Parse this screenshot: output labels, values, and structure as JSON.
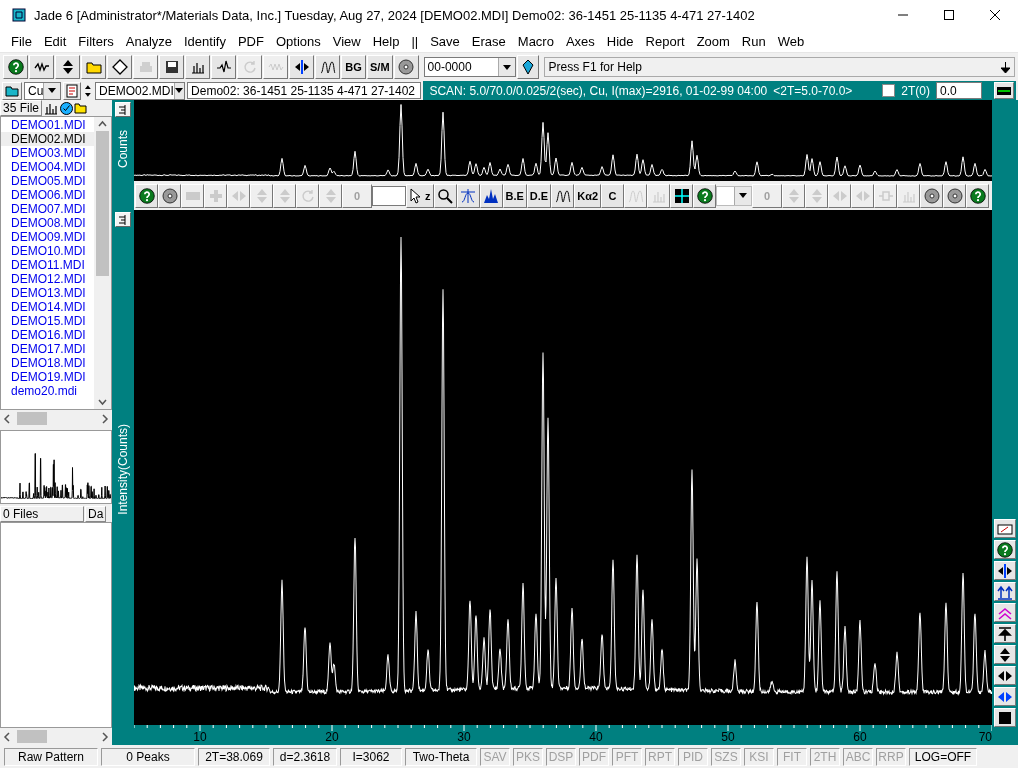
{
  "window": {
    "title": "Jade 6 [Administrator*/Materials Data, Inc.] Tuesday, Aug 27, 2024 [DEMO02.MDI] Demo02: 36-1451 25-1135 4-471 27-1402"
  },
  "menu": [
    "File",
    "Edit",
    "Filters",
    "Analyze",
    "Identify",
    "PDF",
    "Options",
    "View",
    "Help",
    "||",
    "Save",
    "Erase",
    "Macro",
    "Axes",
    "Hide",
    "Report",
    "Zoom",
    "Run",
    "Web"
  ],
  "main_toolbar": {
    "buttons": [
      {
        "kind": "help",
        "disabled": false
      },
      {
        "kind": "scribble",
        "disabled": false
      },
      {
        "kind": "updown",
        "disabled": false
      },
      {
        "kind": "folder",
        "disabled": false
      },
      {
        "kind": "diamond",
        "disabled": false
      },
      {
        "kind": "printer",
        "disabled": true
      },
      {
        "kind": "save",
        "disabled": false
      },
      {
        "kind": "bars",
        "disabled": false
      },
      {
        "kind": "peak",
        "disabled": false
      },
      {
        "kind": "rotate",
        "disabled": true
      },
      {
        "kind": "wave",
        "disabled": true
      },
      {
        "kind": "squeeze",
        "disabled": false
      },
      {
        "kind": "peaks",
        "disabled": false
      },
      {
        "kind": "text",
        "label": "BG",
        "disabled": false
      },
      {
        "kind": "text",
        "label": "S/M",
        "disabled": false
      },
      {
        "kind": "disc",
        "disabled": false
      }
    ],
    "pdf_field": "00-0000",
    "hint": "Press F1 for Help"
  },
  "info_bar": {
    "radiation": "Cu",
    "file_combo": "DEMO02.MDI",
    "pattern_field": "Demo02: 36-1451 25-1135 4-471 27-1402",
    "scan_info": "SCAN: 5.0/70.0/0.025/2(sec), Cu, I(max)=2916, 01-02-99 04:00",
    "range": "<2T=5.0-70.0>",
    "offset_checked": false,
    "offset_label": "2T(0)",
    "offset_value": "0.0"
  },
  "file_panel": {
    "header": "35 File",
    "files": [
      {
        "name": "DEMO01.MDI",
        "selected": false
      },
      {
        "name": "DEMO02.MDI",
        "selected": true
      },
      {
        "name": "DEMO03.MDI",
        "selected": false
      },
      {
        "name": "DEMO04.MDI",
        "selected": false
      },
      {
        "name": "DEMO05.MDI",
        "selected": false
      },
      {
        "name": "DEMO06.MDI",
        "selected": false
      },
      {
        "name": "DEMO07.MDI",
        "selected": false
      },
      {
        "name": "DEMO08.MDI",
        "selected": false
      },
      {
        "name": "DEMO09.MDI",
        "selected": false
      },
      {
        "name": "DEMO10.MDI",
        "selected": false
      },
      {
        "name": "DEMO11.MDI",
        "selected": false
      },
      {
        "name": "DEMO12.MDI",
        "selected": false
      },
      {
        "name": "DEMO13.MDI",
        "selected": false
      },
      {
        "name": "DEMO14.MDI",
        "selected": false
      },
      {
        "name": "DEMO15.MDI",
        "selected": false
      },
      {
        "name": "DEMO16.MDI",
        "selected": false
      },
      {
        "name": "DEMO17.MDI",
        "selected": false
      },
      {
        "name": "DEMO18.MDI",
        "selected": false
      },
      {
        "name": "DEMO19.MDI",
        "selected": false
      },
      {
        "name": "demo20.mdi",
        "selected": false
      }
    ]
  },
  "second_panel": {
    "header": "0 Files",
    "column": "Da"
  },
  "plot": {
    "top_axis_label": "Counts",
    "axis_label": "Intensity(Counts)",
    "toolbar": [
      {
        "kind": "help",
        "disabled": false
      },
      {
        "kind": "disc",
        "disabled": false
      },
      {
        "kind": "minus",
        "disabled": true
      },
      {
        "kind": "plus",
        "disabled": true
      },
      {
        "kind": "leftright",
        "disabled": true
      },
      {
        "kind": "updown",
        "disabled": true
      },
      {
        "kind": "updown",
        "disabled": true
      },
      {
        "kind": "rotate",
        "disabled": true
      },
      {
        "kind": "updown",
        "disabled": true
      },
      {
        "kind": "field",
        "label": "0",
        "disabled": true
      },
      {
        "kind": "blank",
        "disabled": false
      },
      {
        "kind": "cursor",
        "label": "z",
        "disabled": false
      },
      {
        "kind": "magnify",
        "disabled": false
      },
      {
        "kind": "peakline",
        "disabled": false
      },
      {
        "kind": "bluepeaks",
        "disabled": false
      },
      {
        "kind": "text",
        "label": "B.E",
        "disabled": false
      },
      {
        "kind": "text",
        "label": "D.E",
        "disabled": false
      },
      {
        "kind": "peaks",
        "disabled": false
      },
      {
        "kind": "text",
        "label": "Kα2",
        "disabled": false
      },
      {
        "kind": "text",
        "label": "C",
        "disabled": false
      },
      {
        "kind": "peaks",
        "disabled": true
      },
      {
        "kind": "bars",
        "disabled": true
      },
      {
        "kind": "grid",
        "disabled": false
      },
      {
        "kind": "help",
        "disabled": false
      },
      {
        "kind": "combo",
        "disabled": true
      },
      {
        "kind": "field",
        "label": "0",
        "disabled": true
      },
      {
        "kind": "updown",
        "disabled": true
      },
      {
        "kind": "updown",
        "disabled": true
      },
      {
        "kind": "leftright",
        "disabled": true
      },
      {
        "kind": "leftright",
        "disabled": true
      },
      {
        "kind": "plug",
        "disabled": true
      },
      {
        "kind": "bars",
        "disabled": true
      },
      {
        "kind": "disc",
        "disabled": false
      },
      {
        "kind": "disc",
        "disabled": false
      },
      {
        "kind": "help",
        "disabled": false
      }
    ],
    "x_labels": [
      "10",
      "20",
      "30",
      "40",
      "50",
      "60",
      "70"
    ]
  },
  "right_tools": [
    {
      "kind": "gauge",
      "disabled": false
    },
    {
      "kind": "help",
      "disabled": false
    },
    {
      "kind": "squeeze",
      "disabled": false
    },
    {
      "kind": "ups",
      "disabled": false
    },
    {
      "kind": "chevrons",
      "disabled": false
    },
    {
      "kind": "arrowtop",
      "disabled": false
    },
    {
      "kind": "updown",
      "disabled": false
    },
    {
      "kind": "leftright",
      "disabled": false
    },
    {
      "kind": "blueleftright",
      "disabled": false
    },
    {
      "kind": "square",
      "disabled": false
    }
  ],
  "status": [
    {
      "text": "Raw Pattern",
      "disabled": false
    },
    {
      "text": "0 Peaks",
      "disabled": false
    },
    {
      "text": "2T=38.069",
      "disabled": false
    },
    {
      "text": "d=2.3618",
      "disabled": false
    },
    {
      "text": "I=3062",
      "disabled": false
    },
    {
      "text": "Two-Theta",
      "disabled": false
    },
    {
      "text": "SAV",
      "disabled": true
    },
    {
      "text": "PKS",
      "disabled": true
    },
    {
      "text": "DSP",
      "disabled": true
    },
    {
      "text": "PDF",
      "disabled": true
    },
    {
      "text": "PFT",
      "disabled": true
    },
    {
      "text": "RPT",
      "disabled": true
    },
    {
      "text": "PID",
      "disabled": true
    },
    {
      "text": "SZS",
      "disabled": true
    },
    {
      "text": "KSI",
      "disabled": true
    },
    {
      "text": "FIT",
      "disabled": true
    },
    {
      "text": "2TH",
      "disabled": true
    },
    {
      "text": "ABC",
      "disabled": true
    },
    {
      "text": "RRP",
      "disabled": true
    },
    {
      "text": "LOG=OFF",
      "disabled": false
    }
  ]
}
